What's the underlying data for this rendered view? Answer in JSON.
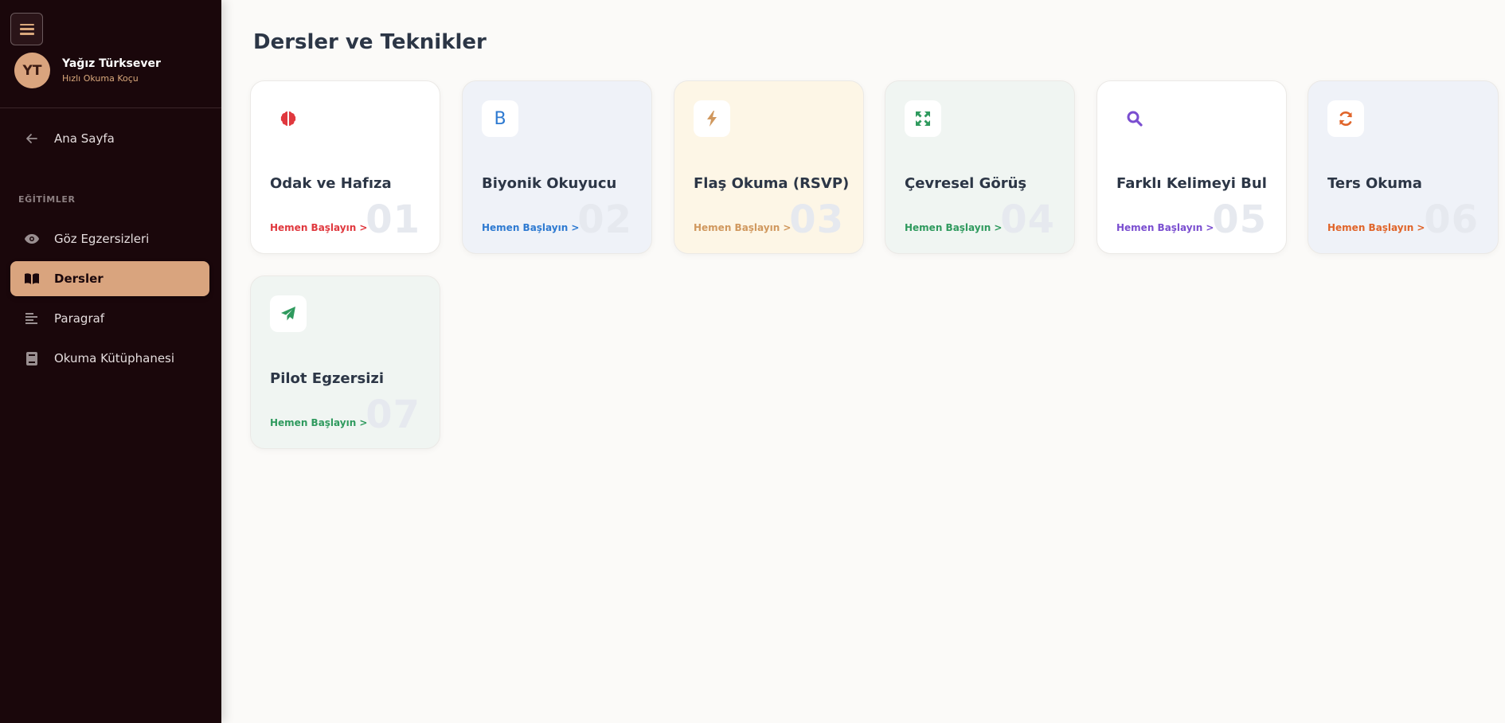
{
  "sidebar": {
    "menu_icon": "hamburger-icon",
    "profile": {
      "initials": "YT",
      "name": "Yağız Türksever",
      "role": "Hızlı Okuma Koçu"
    },
    "home": {
      "label": "Ana Sayfa",
      "icon": "arrow-left-icon"
    },
    "section_label": "EĞİTİMLER",
    "items": [
      {
        "label": "Göz Egzersizleri",
        "icon": "eye-icon",
        "active": false
      },
      {
        "label": "Dersler",
        "icon": "book-open-icon",
        "active": true
      },
      {
        "label": "Paragraf",
        "icon": "align-left-icon",
        "active": false
      },
      {
        "label": "Okuma Kütüphanesi",
        "icon": "book-icon",
        "active": false
      }
    ],
    "colors": {
      "bg": "#1a070b",
      "accent": "#d9a47e"
    }
  },
  "main": {
    "title": "Dersler ve Teknikler",
    "cards": [
      {
        "title": "Odak ve Hafıza",
        "cta": "Hemen Başlayın >",
        "number": "01",
        "icon": "brain-icon",
        "accent": "#e0383e",
        "bg": "#ffffff"
      },
      {
        "title": "Biyonik Okuyucu",
        "cta": "Hemen Başlayın >",
        "number": "02",
        "icon": "bold-b-icon",
        "accent": "#2e7ad1",
        "bg": "#eff2f8"
      },
      {
        "title": "Flaş Okuma (RSVP)",
        "cta": "Hemen Başlayın >",
        "number": "03",
        "icon": "bolt-icon",
        "accent": "#d0985e",
        "bg": "#fdf6e6"
      },
      {
        "title": "Çevresel Görüş",
        "cta": "Hemen Başlayın >",
        "number": "04",
        "icon": "expand-arrows-icon",
        "accent": "#2f9a5e",
        "bg": "#f0f5f2"
      },
      {
        "title": "Farklı Kelimeyi Bul",
        "cta": "Hemen Başlayın >",
        "number": "05",
        "icon": "search-icon",
        "accent": "#7a4ed0",
        "bg": "#ffffff"
      },
      {
        "title": "Ters Okuma",
        "cta": "Hemen Başlayın >",
        "number": "06",
        "icon": "refresh-icon",
        "accent": "#e0652a",
        "bg": "#eff2f8"
      },
      {
        "title": "Pilot Egzersizi",
        "cta": "Hemen Başlayın >",
        "number": "07",
        "icon": "paper-plane-icon",
        "accent": "#2f9a5e",
        "bg": "#f0f5f2"
      }
    ]
  }
}
